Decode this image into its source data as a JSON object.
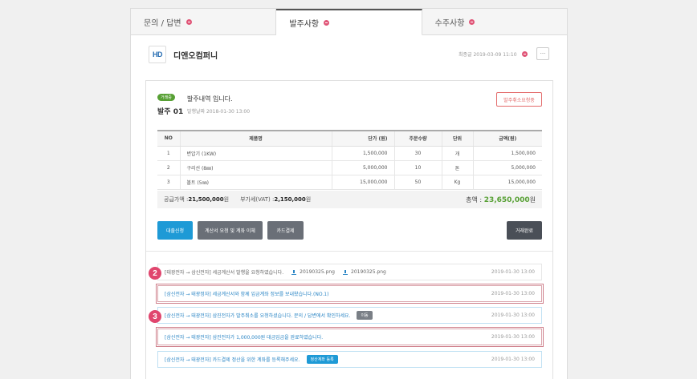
{
  "tabs": [
    {
      "label": "문의 / 답변"
    },
    {
      "label": "발주사항"
    },
    {
      "label": "수주사항"
    }
  ],
  "company": {
    "logo_text": "HD",
    "name": "디앤오컴퍼니",
    "last_updated": "최종글 2019-03-09 11:10",
    "more_label": "···"
  },
  "order": {
    "status": "거래중",
    "id": "발주 01",
    "title": "발주내역 입니다.",
    "date": "발행날짜 2018-01-30 13:00",
    "cancel_label": "발주취소요청중"
  },
  "table": {
    "headers": [
      "NO",
      "제품명",
      "단가 (원)",
      "주문수량",
      "단위",
      "금액(원)"
    ],
    "rows": [
      {
        "no": "1",
        "name": "변압기 (1KW)",
        "price": "1,500,000",
        "qty": "30",
        "unit": "개",
        "amount": "1,500,000"
      },
      {
        "no": "2",
        "name": "구리선 (8㎜)",
        "price": "5,000,000",
        "qty": "10",
        "unit": "톤",
        "amount": "5,000,000"
      },
      {
        "no": "3",
        "name": "볼트 (5㎜)",
        "price": "15,000,000",
        "qty": "50",
        "unit": "Kg",
        "amount": "15,000,000"
      }
    ]
  },
  "summary": {
    "supply_label": "공급가액 : ",
    "supply_value": "21,500,000",
    "supply_unit": "원",
    "vat_label": "부가세(VAT) : ",
    "vat_value": "2,150,000",
    "vat_unit": "원",
    "total_label": "총액 : ",
    "total_value": "23,650,000",
    "total_unit": "원"
  },
  "actions": {
    "loan": "대출신청",
    "invoice": "계산서 요청 및 계좌 이체",
    "card": "카드결제",
    "complete": "거래완료"
  },
  "logs": [
    {
      "text": "[태광전자 → 삼신전자] 세금계산서 발행을 요청하였습니다.",
      "files": [
        "20190325.png",
        "20190325.png"
      ],
      "time": "2019-01-30 13:00"
    },
    {
      "text": "[삼신전자 → 태광정자] 세금계산서와 함께 입금계좌 정보를 보내왔습니다.(NO.1)",
      "time": "2019-01-30 13:00"
    },
    {
      "text": "[삼신전자 → 태광전자] 삼진전자가 발주취소를 요청하셨습니다. 문의 / 답변에서 확인하세요.",
      "button": "이동",
      "time": "2019-01-30 13:00"
    },
    {
      "text": "[삼신전자 → 태광전자] 삼진전자가 1,000,000원 대금입금을 완료하였습니다.",
      "time": "2019-01-30 13:00"
    },
    {
      "text": "[삼신전자 → 태광전자] 카드결제 정산을 위한 계좌를 등록해주세요.",
      "button": "정산계좌 등록",
      "time": "2019-01-30 13:00"
    }
  ],
  "markers": [
    "2",
    "3"
  ]
}
